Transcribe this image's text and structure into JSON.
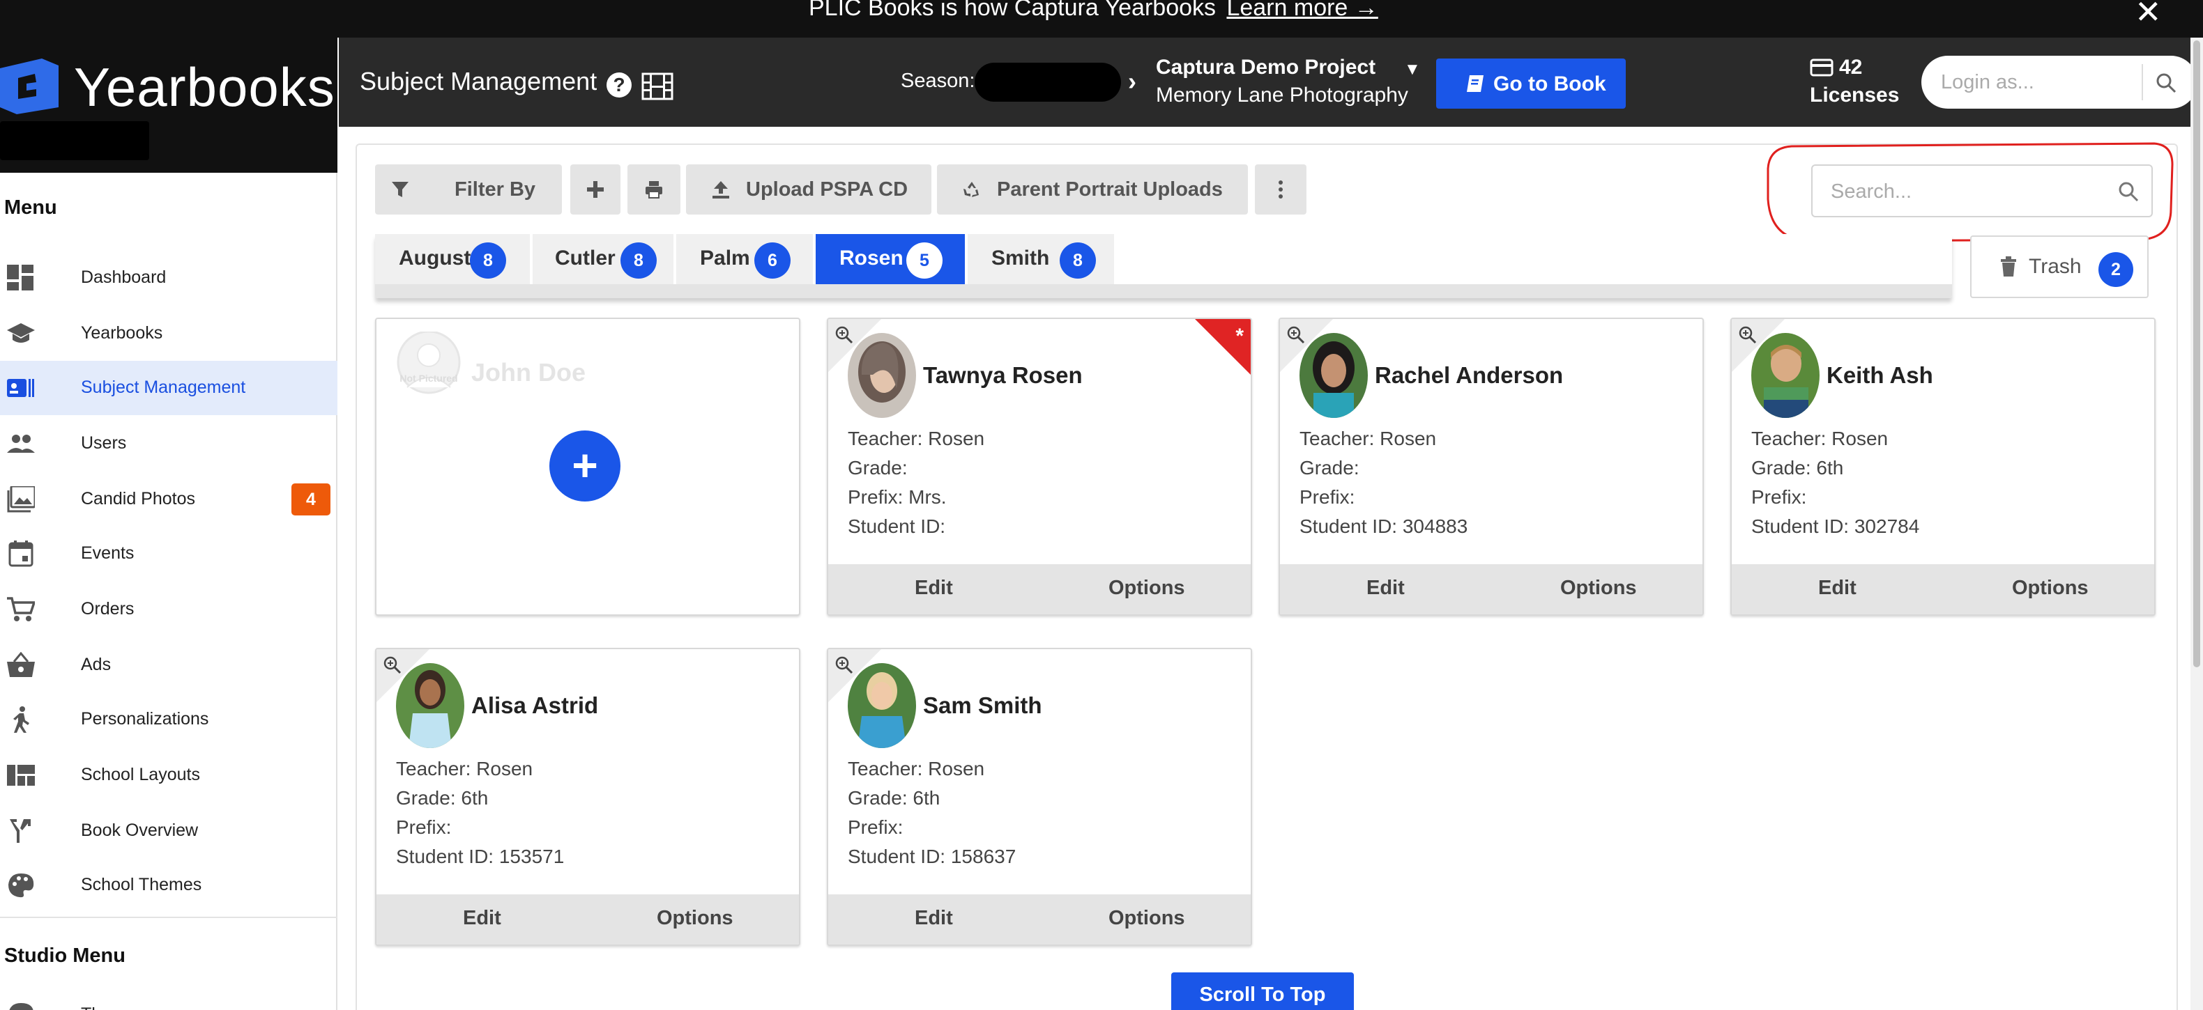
{
  "announcement": {
    "text": "PLIC Books is how Captura Yearbooks",
    "link": "Learn more →",
    "close": "✕"
  },
  "brand": {
    "name": "Yearbooks"
  },
  "sidebar": {
    "menu_heading": "Menu",
    "items": [
      {
        "label": "Dashboard",
        "icon": "dashboard-icon"
      },
      {
        "label": "Yearbooks",
        "icon": "graduation-cap-icon"
      },
      {
        "label": "Subject Management",
        "icon": "id-card-icon",
        "active": true
      },
      {
        "label": "Users",
        "icon": "users-icon"
      },
      {
        "label": "Candid Photos",
        "icon": "photos-icon",
        "badge": "4"
      },
      {
        "label": "Events",
        "icon": "calendar-icon"
      },
      {
        "label": "Orders",
        "icon": "cart-icon"
      },
      {
        "label": "Ads",
        "icon": "basket-icon"
      },
      {
        "label": "Personalizations",
        "icon": "person-walking-icon"
      },
      {
        "label": "School Layouts",
        "icon": "layout-icon"
      },
      {
        "label": "Book Overview",
        "icon": "fork-icon"
      },
      {
        "label": "School Themes",
        "icon": "palette-icon"
      }
    ],
    "studio_heading": "Studio Menu",
    "studio_items": [
      {
        "label": "Themes"
      }
    ]
  },
  "header": {
    "title": "Subject Management",
    "help": "?",
    "season_label": "Season:",
    "project": "Captura Demo Project",
    "studio": "Memory Lane Photography",
    "go_to_book": "Go to Book",
    "licenses_count": "42",
    "licenses_label": "Licenses",
    "login_placeholder": "Login as..."
  },
  "toolbar": {
    "filter_by": "Filter By",
    "upload_pspa": "Upload PSPA CD",
    "parent_uploads": "Parent Portrait Uploads",
    "search_placeholder": "Search..."
  },
  "tabs": [
    {
      "label": "August",
      "count": "8"
    },
    {
      "label": "Cutler",
      "count": "8"
    },
    {
      "label": "Palm",
      "count": "6"
    },
    {
      "label": "Rosen",
      "count": "5",
      "active": true
    },
    {
      "label": "Smith",
      "count": "8"
    }
  ],
  "trash": {
    "label": "Trash",
    "count": "2"
  },
  "add_card": {
    "name": "John Doe",
    "placeholder_text": "Not Pictured",
    "add": "+"
  },
  "cards": [
    {
      "name": "Tawnya Rosen",
      "teacher": "Teacher: Rosen",
      "grade": "Grade:",
      "prefix": "Prefix: Mrs.",
      "student_id": "Student ID:",
      "flagged": true,
      "flag_icon": "*",
      "edit": "Edit",
      "options": "Options"
    },
    {
      "name": "Rachel Anderson",
      "teacher": "Teacher: Rosen",
      "grade": "Grade:",
      "prefix": "Prefix:",
      "student_id": "Student ID: 304883",
      "edit": "Edit",
      "options": "Options"
    },
    {
      "name": "Keith Ash",
      "teacher": "Teacher: Rosen",
      "grade": "Grade: 6th",
      "prefix": "Prefix:",
      "student_id": "Student ID: 302784",
      "edit": "Edit",
      "options": "Options"
    },
    {
      "name": "Alisa Astrid",
      "teacher": "Teacher: Rosen",
      "grade": "Grade: 6th",
      "prefix": "Prefix:",
      "student_id": "Student ID: 153571",
      "edit": "Edit",
      "options": "Options"
    },
    {
      "name": "Sam Smith",
      "teacher": "Teacher: Rosen",
      "grade": "Grade: 6th",
      "prefix": "Prefix:",
      "student_id": "Student ID: 158637",
      "edit": "Edit",
      "options": "Options"
    }
  ],
  "scroll_to_top": "Scroll To Top",
  "colors": {
    "accent": "#1a56e8",
    "badge_orange": "#ee5a0a",
    "flag_red": "#e02424",
    "highlight_ring": "#e0201e"
  }
}
